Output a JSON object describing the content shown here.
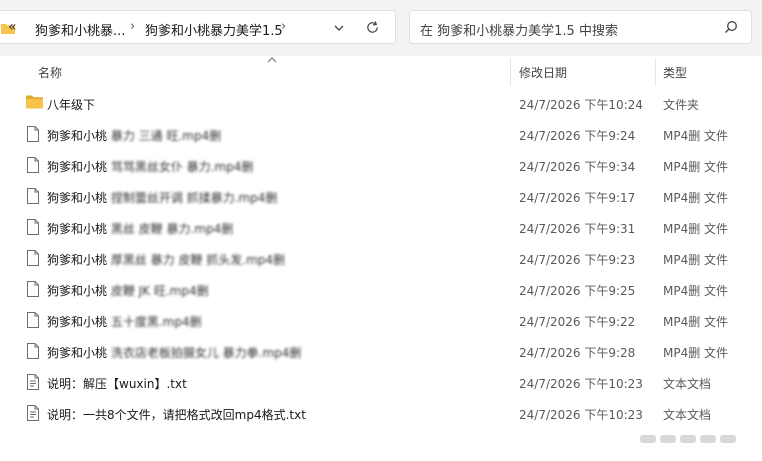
{
  "address": {
    "more": "«",
    "crumbs": [
      "狗爹和小桃暴...",
      "狗爹和小桃暴力美学1.5"
    ],
    "separator": "›"
  },
  "search": {
    "placeholder": "在 狗爹和小桃暴力美学1.5 中搜索"
  },
  "columns": {
    "name": "名称",
    "date": "修改日期",
    "type": "类型"
  },
  "rows": [
    {
      "icon": "folder",
      "name_prefix": "八年级下",
      "name_blurred": "",
      "date": "24/7/2026 下午10:24",
      "type": "文件夹"
    },
    {
      "icon": "file",
      "name_prefix": "狗爹和小桃 ",
      "name_blurred": "暴力 三通 旺.mp4删",
      "date": "24/7/2026 下午9:24",
      "type": "MP4删 文件"
    },
    {
      "icon": "file",
      "name_prefix": "狗爹和小桃 ",
      "name_blurred": "骂骂黑丝女仆 暴力.mp4删",
      "date": "24/7/2026 下午9:34",
      "type": "MP4删 文件"
    },
    {
      "icon": "file",
      "name_prefix": "狗爹和小桃 ",
      "name_blurred": "捏制蕾丝开调 抓揉暴力.mp4删",
      "date": "24/7/2026 下午9:17",
      "type": "MP4删 文件"
    },
    {
      "icon": "file",
      "name_prefix": "狗爹和小桃 ",
      "name_blurred": "黑丝 皮鞭 暴力.mp4删",
      "date": "24/7/2026 下午9:31",
      "type": "MP4删 文件"
    },
    {
      "icon": "file",
      "name_prefix": "狗爹和小桃 ",
      "name_blurred": "厚黑丝 暴力 皮鞭 抓头发.mp4删",
      "date": "24/7/2026 下午9:23",
      "type": "MP4删 文件"
    },
    {
      "icon": "file",
      "name_prefix": "狗爹和小桃 ",
      "name_blurred": "皮鞭 JK 旺.mp4删",
      "date": "24/7/2026 下午9:25",
      "type": "MP4删 文件"
    },
    {
      "icon": "file",
      "name_prefix": "狗爹和小桃 ",
      "name_blurred": "五十度黑.mp4删",
      "date": "24/7/2026 下午9:22",
      "type": "MP4删 文件"
    },
    {
      "icon": "file",
      "name_prefix": "狗爹和小桃 ",
      "name_blurred": "洗衣店老板拍摄女儿 暴力拳.mp4删",
      "date": "24/7/2026 下午9:28",
      "type": "MP4删 文件"
    },
    {
      "icon": "file",
      "name_prefix": "说明：解压【wuxin】.txt",
      "name_blurred": "",
      "date": "24/7/2026 下午10:23",
      "type": "文本文档"
    },
    {
      "icon": "file",
      "name_prefix": "说明：一共8个文件，请把格式改回mp4格式.txt",
      "name_blurred": "",
      "date": "24/7/2026 下午10:23",
      "type": "文本文档"
    }
  ],
  "colors": {
    "folder": "#f8c34b",
    "folder_dark": "#e0a82e",
    "file_border": "#6e6e6e"
  }
}
